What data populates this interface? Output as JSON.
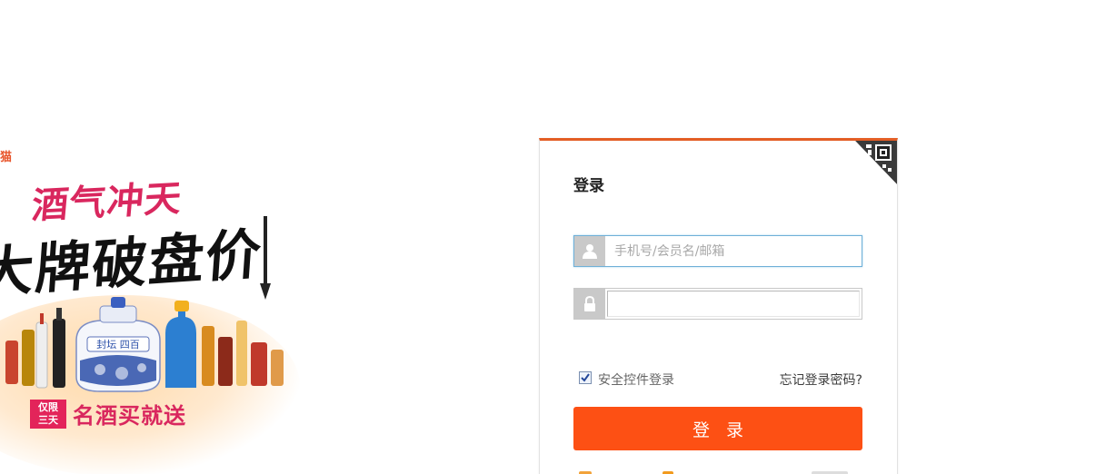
{
  "promo": {
    "brand_mark": "猫",
    "headline_1": "酒气冲天",
    "headline_2": "大牌破盘价",
    "badge_line_1": "仅限",
    "badge_line_2": "三天",
    "slogan": "名酒买就送",
    "bottle_label": "封坛 四百"
  },
  "login": {
    "title": "登录",
    "username_placeholder": "手机号/会员名/邮箱",
    "username_value": "",
    "password_value": "",
    "secure_login_label": "安全控件登录",
    "secure_login_checked": true,
    "forgot_password": "忘记登录密码?",
    "submit_label": "登录"
  },
  "icons": {
    "qr_corner": "qr-code-icon",
    "username": "user-icon",
    "password": "lock-icon",
    "checkbox": "checkmark-icon"
  },
  "colors": {
    "accent_orange": "#fd5014",
    "panel_top_border": "#e35d24",
    "promo_pink": "#d9275e",
    "input_focus_border": "#6fb0d8"
  }
}
